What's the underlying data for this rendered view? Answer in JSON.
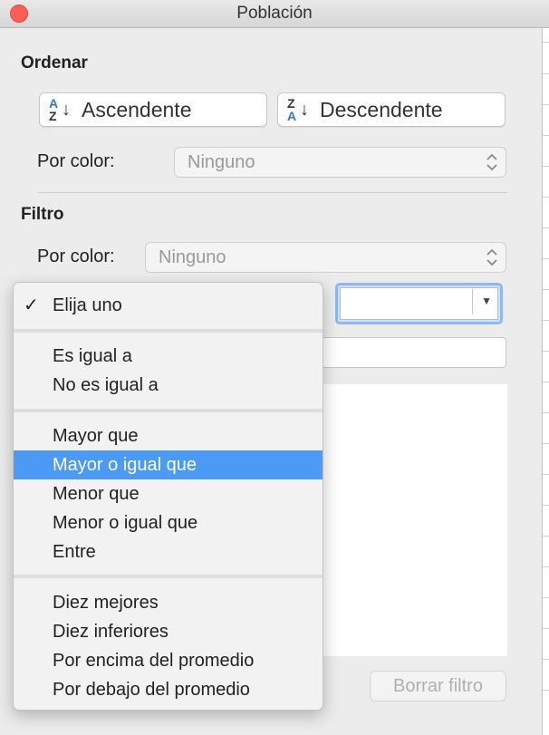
{
  "window": {
    "title": "Población"
  },
  "sort": {
    "section_title": "Ordenar",
    "asc_label": "Ascendente",
    "desc_label": "Descendente",
    "asc_icon_top": "A",
    "asc_icon_bottom": "Z",
    "desc_icon_top": "Z",
    "desc_icon_bottom": "A",
    "by_color_label": "Por color:",
    "by_color_value": "Ninguno"
  },
  "filter": {
    "section_title": "Filtro",
    "by_color_label": "Por color:",
    "by_color_value": "Ninguno",
    "clear_label": "Borrar filtro"
  },
  "menu": {
    "checked_item": "Elija uno",
    "group1": [
      "Es igual a",
      "No es igual a"
    ],
    "group2": [
      "Mayor que",
      "Mayor o igual que",
      "Menor que",
      "Menor o igual que",
      "Entre"
    ],
    "group3": [
      "Diez mejores",
      "Diez inferiores",
      "Por encima del promedio",
      "Por debajo del promedio"
    ],
    "highlighted": "Mayor o igual que"
  },
  "colors": {
    "highlight": "#4b9af6",
    "sort_icon_blue": "#3476c6",
    "close_button": "#fc5f57"
  }
}
